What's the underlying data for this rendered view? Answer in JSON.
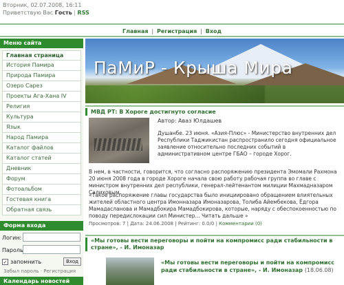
{
  "topbar": {
    "date": "Вторник, 02.07.2008, 16:11",
    "greeting_prefix": "Приветствую Вас",
    "guest": "Гость",
    "separator": "|",
    "rss": "RSS"
  },
  "topnav": {
    "items": [
      "Главная",
      "Регистрация",
      "Вход"
    ],
    "separator": "|"
  },
  "sidebar": {
    "menu_title": "Меню сайта",
    "items": [
      "Главная страница",
      "История Памира",
      "Природа Памира",
      "Озеро Сарез",
      "Проекты Ага-Хана IV",
      "Религия",
      "Культура",
      "Язык",
      "Народ Памира",
      "Каталог файлов",
      "Каталог статей",
      "Дневник",
      "Форум",
      "Фотоальбом",
      "Гостевая книга",
      "Обратная связь"
    ],
    "login_title": "Форма входа",
    "login_label": "Логин:",
    "password_label": "Пароль:",
    "remember_label": "запомнить",
    "remember_checked": "✓",
    "login_button": "Вход",
    "forgot_links": "Забыл пароль · Регистрация",
    "calendar_title": "Календарь новостей"
  },
  "banner": {
    "title": "ПаМиР - Крыша Мира"
  },
  "article1": {
    "title": "МВД РТ: В Хороге достигнуто согласие",
    "author": "Автор: Авaз Юлдашев",
    "p1": "Душанбе. 23 июня. «Азия-Плюс» - Министерство внутренних дел Республики Таджикистан распространило сегодня официальное заявление относительно последних событий в административном центре ГБАО – городе Хорог.",
    "p2": "В нем, в частности, говорится, что согласно распоряжению президента Эмомали Рахмона 20 июня 2008 года в городе Хороге начала свою работу рабочая группа во главе с министром внутренних дел республики, генерал-лейтенантом милиции Махмадназаром Салиховым.",
    "p3": "«Такое распоряжение главы государства было инициировано обращением влиятельных жителей областного центра Имонназара Имоназарова, Толиба Айембекова, Ёдгора Мамадасланова и Мамадбокира Мамадбокирова, которые, наряду с обеспокоенностью по поводу передислокации сил Министер... Читать дальше »",
    "meta_views": "Просмотров: 7",
    "meta_date": "Дата: 24.06.2008",
    "meta_rating": "Рейтинг: 0.0/0",
    "meta_comments": "Комментарии (0)",
    "meta_sep": "|"
  },
  "article2": {
    "title": "«Мы готовы вести переговоры и пойти на компромисс ради стабильности в стране», - И. Имоназар",
    "subtitle": "«Мы готовы вести переговоры и пойти на компромисс ради стабильности в стране», - И. Имоназар",
    "date": "(18.06.08)"
  }
}
